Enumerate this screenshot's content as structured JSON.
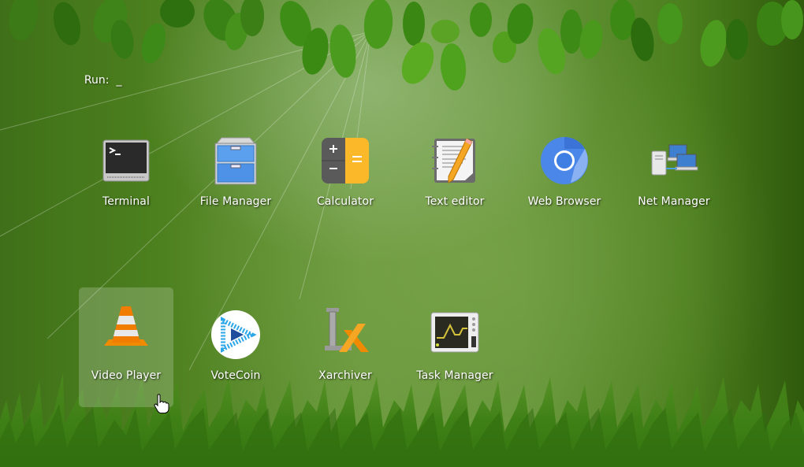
{
  "run_prompt": {
    "label": "Run:",
    "value": "_"
  },
  "apps": [
    {
      "id": "terminal",
      "label": "Terminal",
      "icon": "terminal-icon",
      "selected": false
    },
    {
      "id": "file-manager",
      "label": "File Manager",
      "icon": "file-cabinet-icon",
      "selected": false
    },
    {
      "id": "calculator",
      "label": "Calculator",
      "icon": "calculator-icon",
      "selected": false
    },
    {
      "id": "text-editor",
      "label": "Text editor",
      "icon": "notepad-pencil-icon",
      "selected": false
    },
    {
      "id": "web-browser",
      "label": "Web Browser",
      "icon": "chromium-icon",
      "selected": false
    },
    {
      "id": "net-manager",
      "label": "Net Manager",
      "icon": "network-computers-icon",
      "selected": false
    },
    {
      "id": "video-player",
      "label": "Video Player",
      "icon": "vlc-cone-icon",
      "selected": true
    },
    {
      "id": "votecoin",
      "label": "VoteCoin",
      "icon": "votecoin-play-icon",
      "selected": false
    },
    {
      "id": "xarchiver",
      "label": "Xarchiver",
      "icon": "clamp-x-icon",
      "selected": false
    },
    {
      "id": "task-manager",
      "label": "Task Manager",
      "icon": "system-monitor-icon",
      "selected": false
    }
  ],
  "colors": {
    "label_text": "#ffffff",
    "selection_overlay": "rgba(255,255,255,0.20)",
    "calculator_orange": "#fbb829",
    "browser_blue": "#4a87e8",
    "vlc_orange": "#f08a00"
  }
}
